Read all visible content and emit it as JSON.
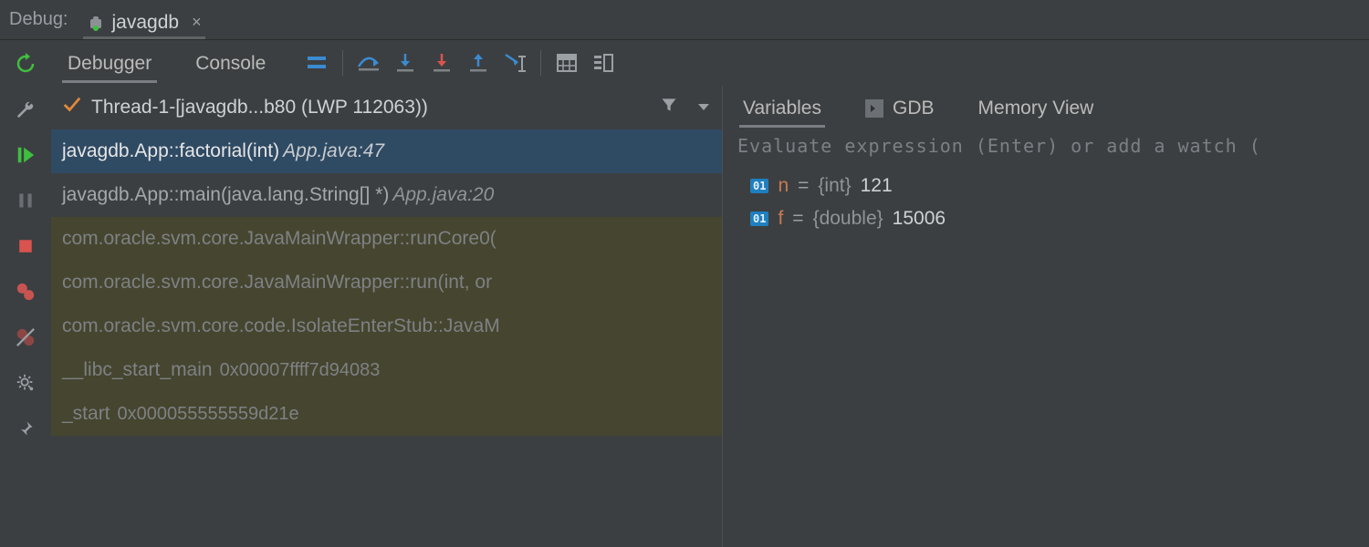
{
  "title": {
    "label": "Debug:"
  },
  "config": {
    "name": "javagdb"
  },
  "subtabs": {
    "debugger": "Debugger",
    "console": "Console"
  },
  "thread": {
    "label": "Thread-1-[javagdb...b80 (LWP 112063))"
  },
  "frames": [
    {
      "text": "javagdb.App::factorial(int)",
      "loc": "App.java:47",
      "kind": "sel"
    },
    {
      "text": "javagdb.App::main(java.lang.String[] *)",
      "loc": "App.java:20",
      "kind": "dim2"
    },
    {
      "text": "com.oracle.svm.core.JavaMainWrapper::runCore0(",
      "loc": "",
      "kind": "dim"
    },
    {
      "text": "com.oracle.svm.core.JavaMainWrapper::run(int, or",
      "loc": "",
      "kind": "dim"
    },
    {
      "text": "com.oracle.svm.core.code.IsolateEnterStub::JavaM",
      "loc": "",
      "kind": "dim"
    },
    {
      "text": "__libc_start_main",
      "addr": "0x00007ffff7d94083",
      "kind": "dim"
    },
    {
      "text": "_start",
      "addr": "0x000055555559d21e",
      "kind": "dim"
    }
  ],
  "varsTabs": {
    "variables": "Variables",
    "gdb": "GDB",
    "memory": "Memory View"
  },
  "evalPlaceholder": "Evaluate expression (Enter) or add a watch (",
  "vars": [
    {
      "name": "n",
      "type": "{int}",
      "value": "121"
    },
    {
      "name": "f",
      "type": "{double}",
      "value": "15006"
    }
  ]
}
